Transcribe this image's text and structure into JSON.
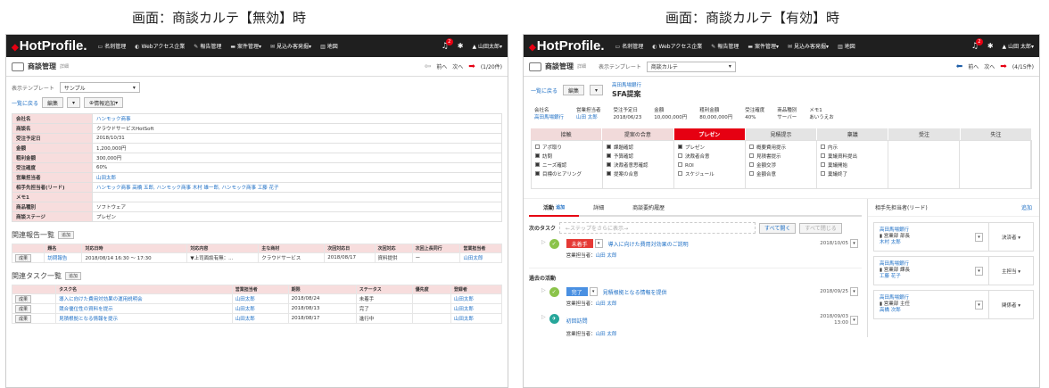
{
  "captions": {
    "left": "画面：商談カルテ【無効】時",
    "right": "画面：商談カルテ【有効】時"
  },
  "app": {
    "logo": "HotProfile.",
    "nav": [
      {
        "icon": "card-icon",
        "glyph": "▭",
        "label": "名刺管理"
      },
      {
        "icon": "web-icon",
        "glyph": "◐",
        "label": "Webアクセス企業"
      },
      {
        "icon": "report-icon",
        "glyph": "✎",
        "label": "報告管理"
      },
      {
        "icon": "case-icon",
        "glyph": "▬",
        "label": "案件管理▾"
      },
      {
        "icon": "prospect-icon",
        "glyph": "✉",
        "label": "見込み客発掘▾"
      },
      {
        "icon": "map-icon",
        "glyph": "▥",
        "label": "地図"
      }
    ],
    "notification_count": "2",
    "user": "山田太郎▾",
    "user_right": "山田 太郎▾"
  },
  "left": {
    "page_title": "商談管理",
    "page_sub": "詳細",
    "pager": {
      "prev": "前へ",
      "next": "次へ",
      "count": "(1/20件)"
    },
    "template_label": "表示テンプレート",
    "template_value": "サンプル",
    "back_link": "一覧に戻る",
    "edit": "編集",
    "add_info": "情報追加",
    "fields": [
      {
        "k": "会社名",
        "v": "ハンモック商事",
        "link": true
      },
      {
        "k": "商談名",
        "v": "クラウドサービスHotSoft",
        "link": false
      },
      {
        "k": "受注予定日",
        "v": "2018/10/31",
        "link": false
      },
      {
        "k": "金額",
        "v": "1,200,000円",
        "link": false
      },
      {
        "k": "粗利金額",
        "v": "300,000円",
        "link": false
      },
      {
        "k": "受注確度",
        "v": "60%",
        "link": false
      },
      {
        "k": "営業担当者",
        "v": "山田太郎",
        "link": true
      },
      {
        "k": "相手先担当者(リード)",
        "v": "ハンモック商事 高橋 五郎, ハンモック商事 木村 雄一郎, ハンモック商事 工藤 花子",
        "link": true
      },
      {
        "k": "メモ1",
        "v": "",
        "link": false
      },
      {
        "k": "商品種別",
        "v": "ソフトウェア",
        "link": false
      },
      {
        "k": "商談ステージ",
        "v": "プレゼン",
        "link": false
      }
    ],
    "reports_title": "関連報告一覧",
    "add": "追加",
    "report_headers": [
      "",
      "題名",
      "対応日時",
      "対応内容",
      "主な商材",
      "次回対応日",
      "次回対応",
      "次回上長同行",
      "営業担当者"
    ],
    "report_rows": [
      [
        "成果",
        "訪問報告",
        "2018/08/14 16:30 ～ 17:30",
        "▼上司面談有無：...",
        "クラウドサービス",
        "2018/08/17",
        "資料提供",
        "ー",
        "山田太郎"
      ]
    ],
    "tasks_title": "関連タスク一覧",
    "task_headers": [
      "",
      "タスク名",
      "営業担当者",
      "期限",
      "ステータス",
      "優先度",
      "登録者"
    ],
    "task_rows": [
      [
        "成果",
        "導入に向けた費用対効果の運用説明会",
        "山田太郎",
        "2018/08/24",
        "未着手",
        "",
        "山田太郎"
      ],
      [
        "成果",
        "競合優位性の資料を提示",
        "山田太郎",
        "2018/08/13",
        "完了",
        "",
        "山田太郎"
      ],
      [
        "成果",
        "見積根拠となる情報を提示",
        "山田太郎",
        "2018/08/17",
        "進行中",
        "",
        "山田太郎"
      ]
    ]
  },
  "right": {
    "page_title": "商談管理",
    "page_sub": "詳細",
    "template_label": "表示テンプレート",
    "template_value": "商談カルテ",
    "pager": {
      "prev": "前へ",
      "next": "次へ",
      "count": "(4/15件)"
    },
    "back_link": "一覧に戻る",
    "edit": "編集",
    "company_small": "高田馬場銀行",
    "deal_title": "SFA提案",
    "summary": [
      {
        "k": "会社名",
        "v": "高田馬場銀行",
        "link": true
      },
      {
        "k": "営業担当者",
        "v": "山田 太郎",
        "link": true
      },
      {
        "k": "受注予定日",
        "v": "2018/06/23",
        "link": false
      },
      {
        "k": "金額",
        "v": "10,000,000円",
        "link": false
      },
      {
        "k": "粗利金額",
        "v": "80,000,000円",
        "link": false
      },
      {
        "k": "受注確度",
        "v": "40%",
        "link": false
      },
      {
        "k": "商品種別",
        "v": "サーバー",
        "link": false
      },
      {
        "k": "メモ1",
        "v": "あいうえお",
        "link": false
      }
    ],
    "stages": [
      {
        "label": "接触",
        "state": "done"
      },
      {
        "label": "提案の合意",
        "state": "done"
      },
      {
        "label": "プレゼン",
        "state": "active"
      },
      {
        "label": "見積提示",
        "state": "todo"
      },
      {
        "label": "稟議",
        "state": "todo"
      },
      {
        "label": "受注",
        "state": "grey"
      },
      {
        "label": "失注",
        "state": "grey"
      }
    ],
    "checks": [
      [
        {
          "t": "アポ取り",
          "on": false
        },
        {
          "t": "訪問",
          "on": true
        },
        {
          "t": "ニーズ確認",
          "on": true
        },
        {
          "t": "目標のヒアリング",
          "on": true
        }
      ],
      [
        {
          "t": "課題確認",
          "on": true
        },
        {
          "t": "予算確認",
          "on": true
        },
        {
          "t": "決裁者意思確認",
          "on": true
        },
        {
          "t": "提案の合意",
          "on": true
        }
      ],
      [
        {
          "t": "プレゼン",
          "on": true
        },
        {
          "t": "決裁者合意",
          "on": false
        },
        {
          "t": "ROI",
          "on": false
        },
        {
          "t": "スケジュール",
          "on": false
        }
      ],
      [
        {
          "t": "概要費用提示",
          "on": false
        },
        {
          "t": "見積書提示",
          "on": false
        },
        {
          "t": "金額交渉",
          "on": false
        },
        {
          "t": "金額合意",
          "on": false
        }
      ],
      [
        {
          "t": "内示",
          "on": false
        },
        {
          "t": "稟議資料提出",
          "on": false
        },
        {
          "t": "稟議開始",
          "on": false
        },
        {
          "t": "稟議終了",
          "on": false
        }
      ],
      [],
      []
    ],
    "tabs": {
      "activity": "活動",
      "activity_add": "追加",
      "detail": "詳細",
      "history": "商談要約履歴"
    },
    "next_task_label": "次のタスク",
    "step_placeholder": "ステップをさらに表示",
    "open_all": "すべて開く",
    "close_all": "すべて閉じる",
    "past_label": "過去の活動",
    "activities": [
      {
        "status": "未着手",
        "status_color": "#e53935",
        "title": "導入に向けた費用対効果のご説明",
        "date": "2018/10/05",
        "time": "",
        "owner_label": "営業担当者：",
        "owner": "山田 太郎",
        "kind": "check"
      },
      {
        "status": "完了",
        "status_color": "#4a90e2",
        "title": "見積根拠となる情報を提供",
        "date": "2018/09/25",
        "time": "",
        "owner_label": "営業担当者：",
        "owner": "山田 太郎",
        "kind": "check"
      },
      {
        "status": "",
        "status_color": "",
        "title": "初回訪問",
        "date": "2018/09/03",
        "time": "13:00",
        "owner_label": "営業担当者：",
        "owner": "山田 太郎",
        "kind": "visit"
      }
    ],
    "contacts_title": "相手先担当者(リード)",
    "contacts_add": "追加",
    "contacts": [
      {
        "company": "高田馬場銀行",
        "dept": "営業部 部長",
        "name": "木村 太郎",
        "role": "決済者"
      },
      {
        "company": "高田馬場銀行",
        "dept": "営業部 課長",
        "name": "工藤 花子",
        "role": "主担当"
      },
      {
        "company": "高田馬場銀行",
        "dept": "営業部 主任",
        "name": "高橋 次郎",
        "role": "関係者"
      }
    ]
  }
}
